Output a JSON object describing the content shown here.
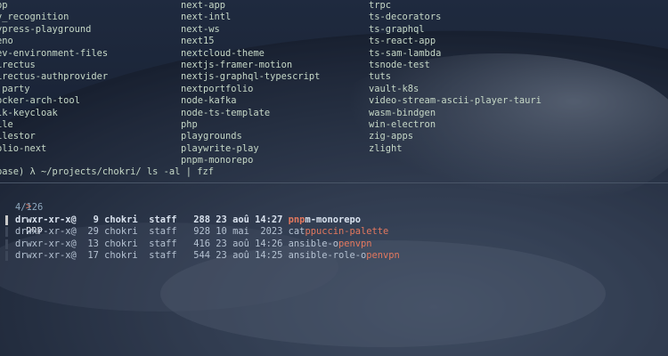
{
  "listing": {
    "col1": [
      "pp",
      "v_recognition",
      "ypress-playground",
      "eno",
      "ev-environment-files",
      "irectus",
      "irectus-authprovider",
      "jparty",
      "ocker-arch-tool",
      "lk-keycloak",
      "ile",
      "ilestor",
      "olio-next"
    ],
    "col2": [
      "next-app",
      "next-intl",
      "next-ws",
      "next15",
      "nextcloud-theme",
      "nextjs-framer-motion",
      "nextjs-graphql-typescript",
      "nextportfolio",
      "node-kafka",
      "node-ts-template",
      "php",
      "playgrounds",
      "playwrite-play",
      "pnpm-monorepo"
    ],
    "col3": [
      "trpc",
      "ts-decorators",
      "ts-graphql",
      "ts-react-app",
      "ts-sam-lambda",
      "tsnode-test",
      "tuts",
      "vault-k8s",
      "video-stream-ascii-player-tauri",
      "wasm-bindgen",
      "win-electron",
      "zig-apps",
      "zlight"
    ]
  },
  "prompt": {
    "text": "base) λ ~/projects/chokri/ ls -al | fzf"
  },
  "fzf": {
    "query_prefix": ">",
    "query": "pnp",
    "count": "4/126",
    "rows": [
      {
        "perm": "drwxr-xr-x@",
        "links": "9",
        "owner": "chokri",
        "group": "staff",
        "size": "288",
        "day": "23",
        "month": "aoû",
        "time": "14:27",
        "name_pre": "",
        "name_match": "pnp",
        "name_post": "m-monorepo"
      },
      {
        "perm": "drwxr-xr-x@",
        "links": "29",
        "owner": "chokri",
        "group": "staff",
        "size": "928",
        "day": "10",
        "month": "mai",
        "time": "2023",
        "name_pre": "cat",
        "name_match": "ppuccin-palette",
        "name_post": ""
      },
      {
        "perm": "drwxr-xr-x@",
        "links": "13",
        "owner": "chokri",
        "group": "staff",
        "size": "416",
        "day": "23",
        "month": "aoû",
        "time": "14:26",
        "name_pre": "ansible-o",
        "name_match": "penvpn",
        "name_post": ""
      },
      {
        "perm": "drwxr-xr-x@",
        "links": "17",
        "owner": "chokri",
        "group": "staff",
        "size": "544",
        "day": "23",
        "month": "aoû",
        "time": "14:25",
        "name_pre": "ansible-role-o",
        "name_match": "penvpn",
        "name_post": ""
      }
    ]
  },
  "colors": {
    "listing_text": "#c6d8c7",
    "match": "#e3785e",
    "cursor_bar": "#c8c8c8",
    "separator": "#4a5668"
  }
}
